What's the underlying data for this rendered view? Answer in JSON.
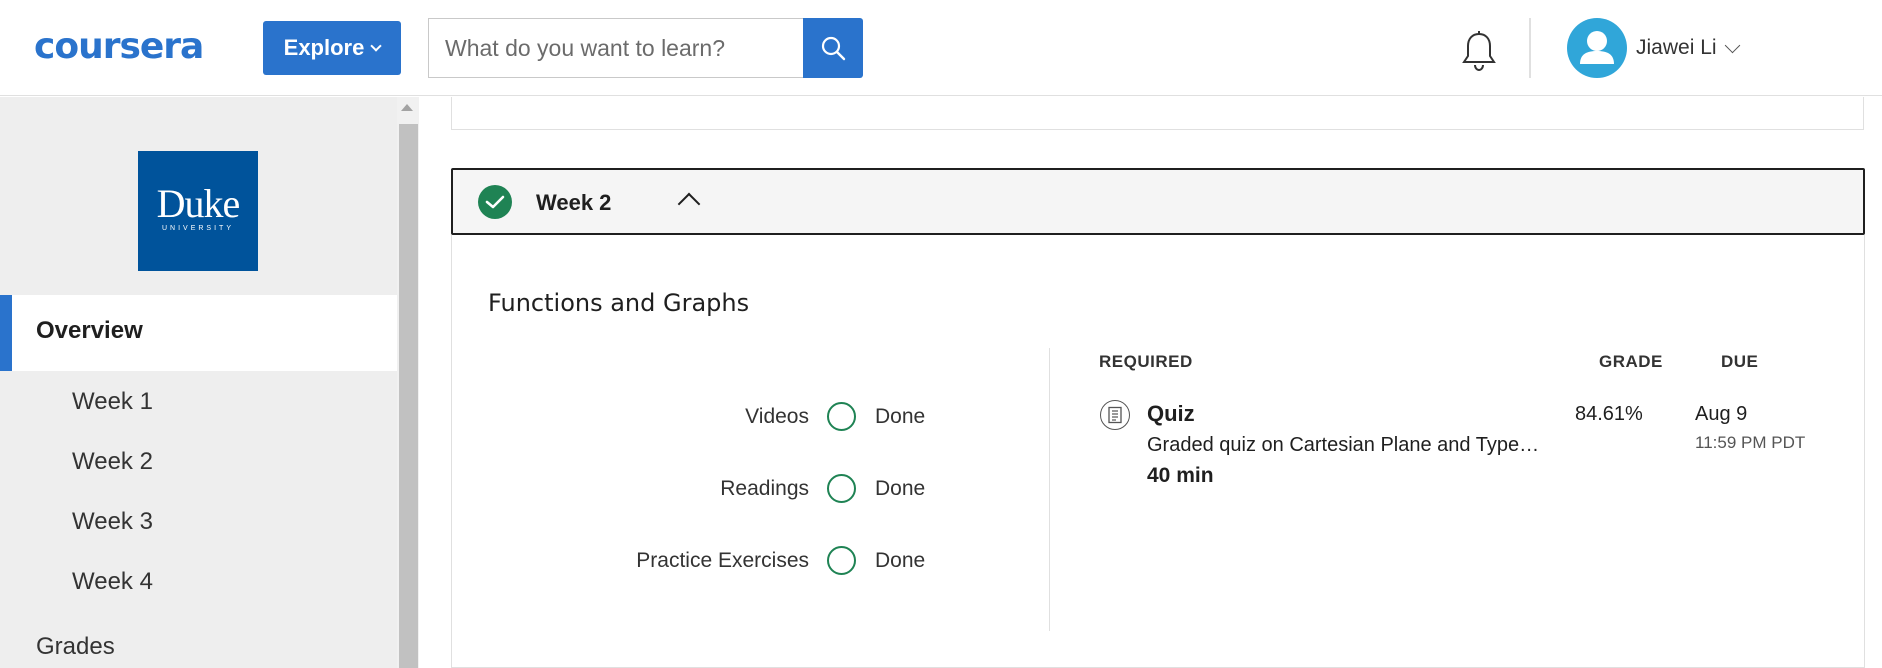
{
  "header": {
    "logo_text": "coursera",
    "explore_label": "Explore",
    "search_placeholder": "What do you want to learn?",
    "user_name": "Jiawei Li"
  },
  "sidebar": {
    "university_logo_main": "Duke",
    "university_logo_sub": "UNIVERSITY",
    "overview_label": "Overview",
    "weeks": [
      "Week 1",
      "Week 2",
      "Week 3",
      "Week 4"
    ],
    "grades_label": "Grades"
  },
  "week": {
    "title": "Week 2",
    "completed": true,
    "module_title": "Functions and Graphs",
    "stats": [
      {
        "label": "Videos",
        "status": "Done"
      },
      {
        "label": "Readings",
        "status": "Done"
      },
      {
        "label": "Practice Exercises",
        "status": "Done"
      }
    ],
    "columns": {
      "required": "REQUIRED",
      "grade": "GRADE",
      "due": "DUE"
    },
    "items": [
      {
        "type": "Quiz",
        "description": "Graded quiz on Cartesian Plane and Types of Function",
        "duration": "40 min",
        "grade": "84.61%",
        "due_date": "Aug 9",
        "due_time": "11:59 PM PDT"
      }
    ]
  },
  "colors": {
    "brand_blue": "#2a73cc",
    "success_green": "#1f8354",
    "duke_blue": "#00539b",
    "avatar_blue": "#30a6d9"
  },
  "icons": [
    "search-icon",
    "bell-icon",
    "user-icon",
    "checkmark-icon",
    "chevron-up-icon",
    "quiz-icon"
  ]
}
